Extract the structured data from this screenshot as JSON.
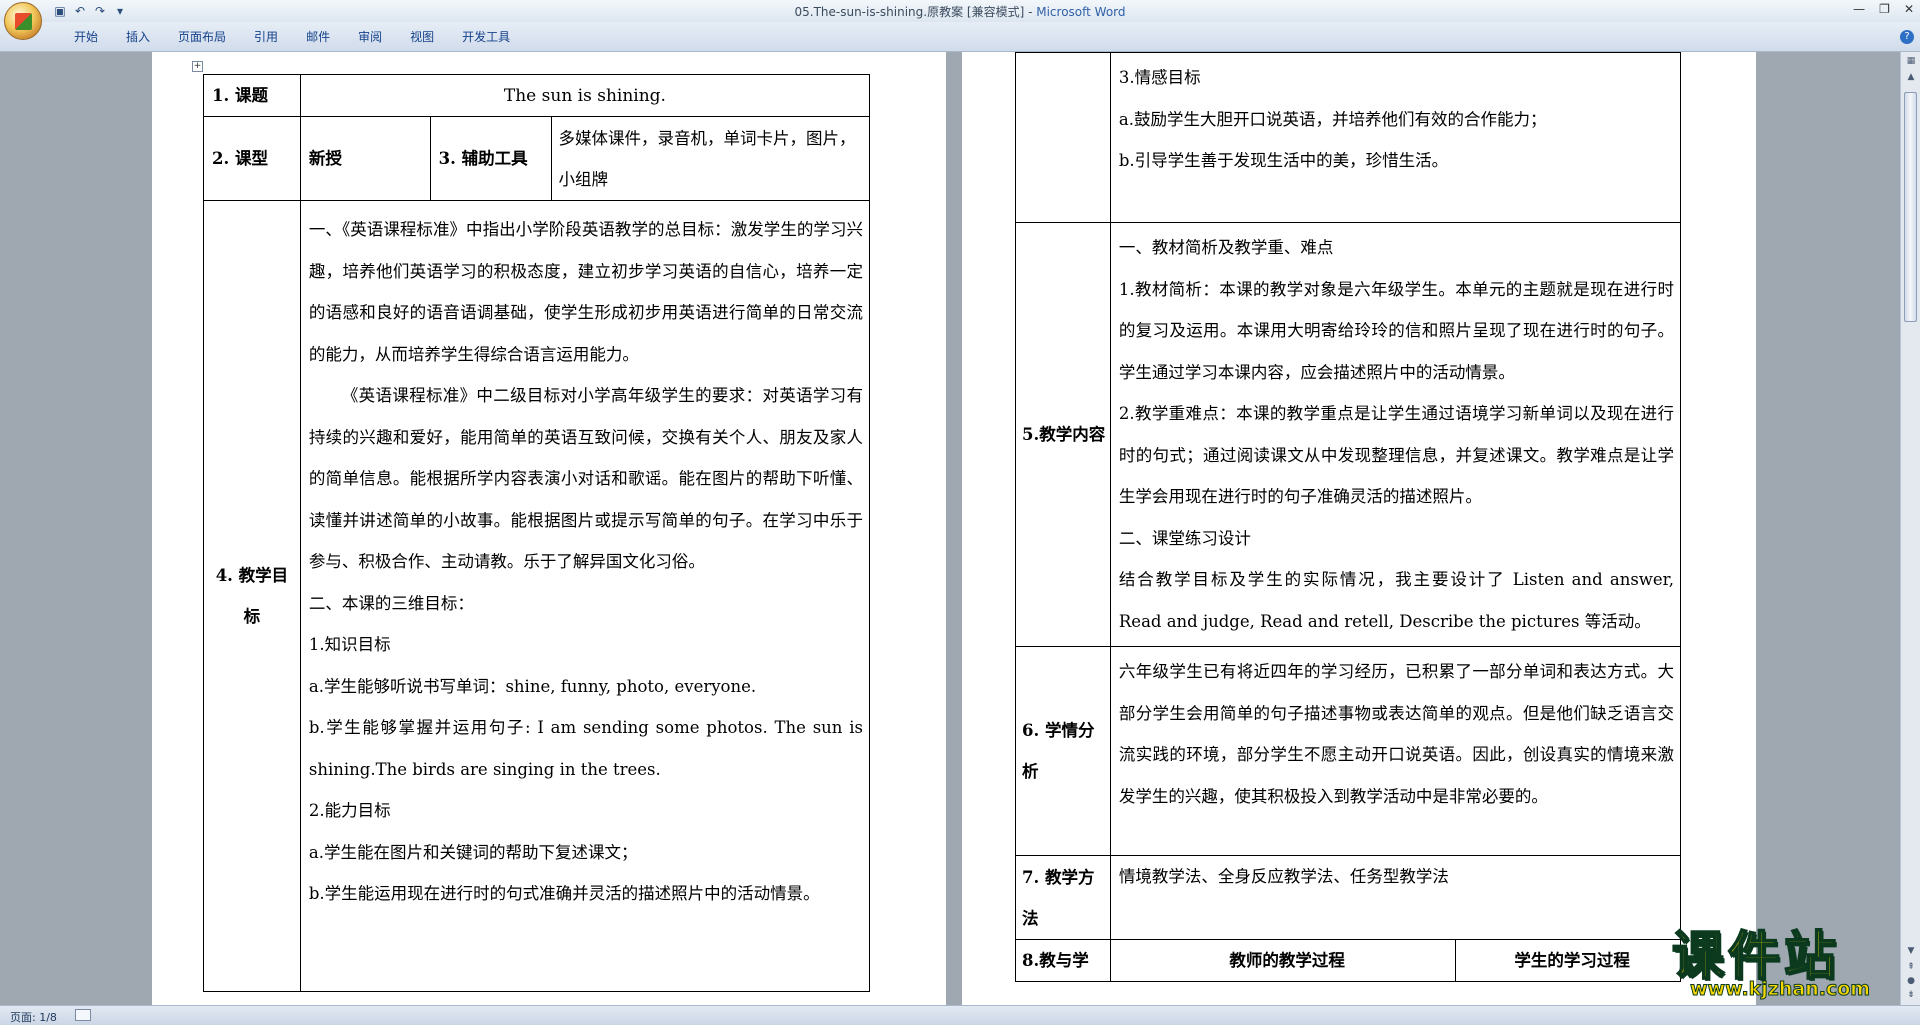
{
  "window": {
    "title_doc": "05.The-sun-is-shining.原教案 [兼容模式] - ",
    "title_app": "Microsoft Word"
  },
  "ribbon": {
    "tabs": [
      "开始",
      "插入",
      "页面布局",
      "引用",
      "邮件",
      "审阅",
      "视图",
      "开发工具"
    ]
  },
  "status": {
    "page": "页面: 1/8"
  },
  "watermark": {
    "text": "课件站",
    "url": "www.kjzhan.com"
  },
  "table1": {
    "r1_label": "1. 课题",
    "r1_value": "The sun is shining.",
    "r2_label": "2. 课型",
    "r2_value": "新授",
    "r2_label2": "3. 辅助工具",
    "r2_value2": "多媒体课件，录音机，单词卡片，图片，小组牌",
    "r3_label": "4. 教学目标",
    "p1": "一、《英语课程标准》中指出小学阶段英语教学的总目标：激发学生的学习兴趣，培养他们英语学习的积极态度，建立初步学习英语的自信心，培养一定的语感和良好的语音语调基础，使学生形成初步用英语进行简单的日常交流的能力，从而培养学生得综合语言运用能力。",
    "p2": "《英语课程标准》中二级目标对小学高年级学生的要求：对英语学习有持续的兴趣和爱好，能用简单的英语互致问候，交换有关个人、朋友及家人的简单信息。能根据所学内容表演小对话和歌谣。能在图片的帮助下听懂、读懂并讲述简单的小故事。能根据图片或提示写简单的句子。在学习中乐于参与、积极合作、主动请教。乐于了解异国文化习俗。",
    "p3": "二、本课的三维目标：",
    "p4": "1.知识目标",
    "p5": "a.学生能够听说书写单词：shine, funny, photo, everyone.",
    "p6": "b.学生能够掌握并运用句子: I am sending some photos. The sun is shining.The birds are singing in the trees.",
    "p7": "2.能力目标",
    "p8": "a.学生能在图片和关键词的帮助下复述课文；",
    "p9": "b.学生能运用现在进行时的句式准确并灵活的描述照片中的活动情景。"
  },
  "table2": {
    "r0_l1": "3.情感目标",
    "r0_l2": "a.鼓励学生大胆开口说英语，并培养他们有效的合作能力；",
    "r0_l3": "b.引导学生善于发现生活中的美，珍惜生活。",
    "r1_label": "5.教学内容",
    "r1_p1": "一、教材简析及教学重、难点",
    "r1_p2": "1.教材简析：本课的教学对象是六年级学生。本单元的主题就是现在进行时的复习及运用。本课用大明寄给玲玲的信和照片呈现了现在进行时的句子。学生通过学习本课内容，应会描述照片中的活动情景。",
    "r1_p3": "2.教学重难点：本课的教学重点是让学生通过语境学习新单词以及现在进行时的句式；通过阅读课文从中发现整理信息，并复述课文。教学难点是让学生学会用现在进行时的句子准确灵活的描述照片。",
    "r1_p4": "二、课堂练习设计",
    "r1_p5": "结合教学目标及学生的实际情况，我主要设计了 Listen and answer, Read and judge, Read and retell, Describe the pictures 等活动。",
    "r2_label": "6. 学情分析",
    "r2_p1": "六年级学生已有将近四年的学习经历，已积累了一部分单词和表达方式。大部分学生会用简单的句子描述事物或表达简单的观点。但是他们缺乏语言交流实践的环境，部分学生不愿主动开口说英语。因此，创设真实的情境来激发学生的兴趣，使其积极投入到教学活动中是非常必要的。",
    "r3_label": "7. 教学方法",
    "r3_p1": "情境教学法、全身反应教学法、任务型教学法",
    "r4_label": "8.教与学",
    "r4_c2": "教师的教学过程",
    "r4_c3": "学生的学习过程"
  }
}
